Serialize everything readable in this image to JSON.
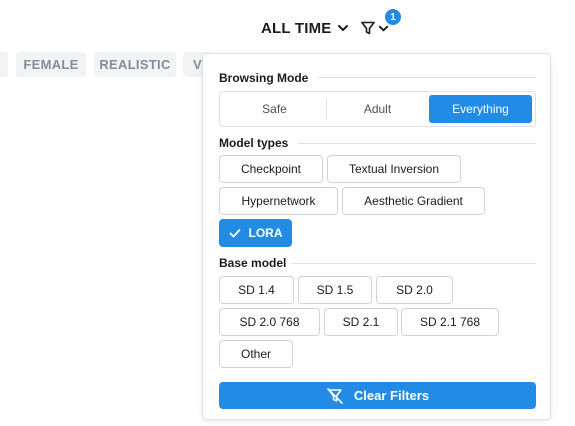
{
  "header": {
    "period_label": "ALL TIME",
    "period_icon": "chevron-down-icon",
    "filter_icon": "filter-icon",
    "filter_count": "1"
  },
  "tags": [
    "FEMALE",
    "REALISTIC",
    "V"
  ],
  "filters": {
    "browsing_mode": {
      "title": "Browsing Mode",
      "options": [
        "Safe",
        "Adult",
        "Everything"
      ],
      "selected": "Everything"
    },
    "model_types": {
      "title": "Model types",
      "options": [
        "Checkpoint",
        "Textual Inversion",
        "Hypernetwork",
        "Aesthetic Gradient",
        "LORA"
      ],
      "selected": [
        "LORA"
      ]
    },
    "base_model": {
      "title": "Base model",
      "options": [
        "SD 1.4",
        "SD 1.5",
        "SD 2.0",
        "SD 2.0 768",
        "SD 2.1",
        "SD 2.1 768",
        "Other"
      ]
    },
    "clear_label": "Clear Filters",
    "clear_icon": "filter-off-icon"
  },
  "colors": {
    "accent": "#228be6",
    "muted_text": "#868e96",
    "chip_bg": "#f1f3f5"
  }
}
